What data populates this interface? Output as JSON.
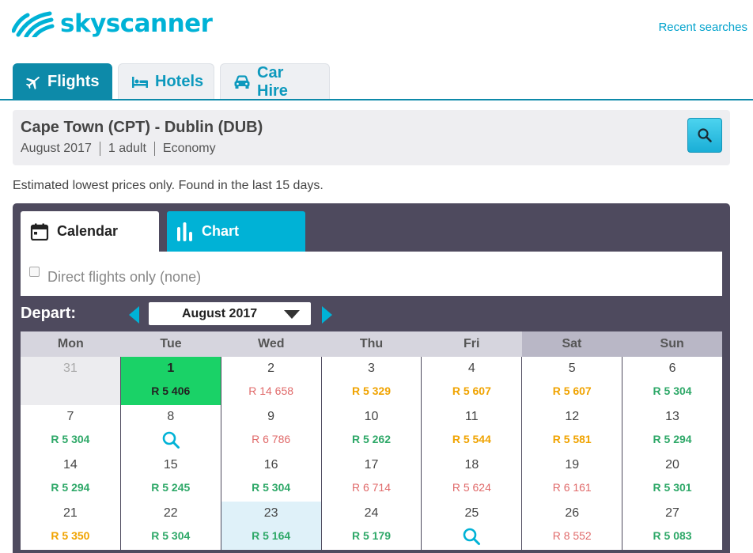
{
  "brand": {
    "name": "skyscanner",
    "color": "#00b2d6"
  },
  "header": {
    "recent_searches": "Recent searches"
  },
  "tabs": [
    {
      "label": "Flights",
      "icon": "plane-icon",
      "active": true
    },
    {
      "label": "Hotels",
      "icon": "bed-icon",
      "active": false
    },
    {
      "label": "Car Hire",
      "icon": "car-icon",
      "active": false
    }
  ],
  "summary": {
    "route": "Cape Town (CPT) - Dublin (DUB)",
    "month": "August 2017",
    "travellers": "1 adult",
    "cabin": "Economy",
    "search_icon": "search-icon"
  },
  "notice": "Estimated lowest prices only. Found in the last 15 days.",
  "panel": {
    "tabs": [
      {
        "label": "Calendar",
        "icon": "calendar-icon",
        "active": true
      },
      {
        "label": "Chart",
        "icon": "bar-chart-icon",
        "active": false
      }
    ],
    "direct_label": "Direct flights only (none)",
    "depart_label": "Depart:",
    "month_value": "August 2017"
  },
  "calendar": {
    "weekdays": [
      "Mon",
      "Tue",
      "Wed",
      "Thu",
      "Fri",
      "Sat",
      "Sun"
    ],
    "weeks": [
      [
        {
          "day": "31",
          "price": "",
          "state": "outside"
        },
        {
          "day": "1",
          "price": "R 5 406",
          "tone": "black",
          "state": "selected"
        },
        {
          "day": "2",
          "price": "R 14 658",
          "tone": "red"
        },
        {
          "day": "3",
          "price": "R 5 329",
          "tone": "orange"
        },
        {
          "day": "4",
          "price": "R 5 607",
          "tone": "orange"
        },
        {
          "day": "5",
          "price": "R 5 607",
          "tone": "orange"
        },
        {
          "day": "6",
          "price": "R 5 304",
          "tone": "green"
        }
      ],
      [
        {
          "day": "7",
          "price": "R 5 304",
          "tone": "green"
        },
        {
          "day": "8",
          "price": "",
          "state": "search"
        },
        {
          "day": "9",
          "price": "R 6 786",
          "tone": "red"
        },
        {
          "day": "10",
          "price": "R 5 262",
          "tone": "green"
        },
        {
          "day": "11",
          "price": "R 5 544",
          "tone": "orange"
        },
        {
          "day": "12",
          "price": "R 5 581",
          "tone": "orange"
        },
        {
          "day": "13",
          "price": "R 5 294",
          "tone": "green"
        }
      ],
      [
        {
          "day": "14",
          "price": "R 5 294",
          "tone": "green"
        },
        {
          "day": "15",
          "price": "R 5 245",
          "tone": "green"
        },
        {
          "day": "16",
          "price": "R 5 304",
          "tone": "green"
        },
        {
          "day": "17",
          "price": "R 6 714",
          "tone": "red"
        },
        {
          "day": "18",
          "price": "R 5 624",
          "tone": "red"
        },
        {
          "day": "19",
          "price": "R 6 161",
          "tone": "red"
        },
        {
          "day": "20",
          "price": "R 5 301",
          "tone": "green"
        }
      ],
      [
        {
          "day": "21",
          "price": "R 5 350",
          "tone": "orange"
        },
        {
          "day": "22",
          "price": "R 5 304",
          "tone": "green"
        },
        {
          "day": "23",
          "price": "R 5 164",
          "tone": "green",
          "state": "hilite"
        },
        {
          "day": "24",
          "price": "R 5 179",
          "tone": "green"
        },
        {
          "day": "25",
          "price": "",
          "state": "search"
        },
        {
          "day": "26",
          "price": "R 8 552",
          "tone": "red"
        },
        {
          "day": "27",
          "price": "R 5 083",
          "tone": "green"
        }
      ]
    ]
  }
}
